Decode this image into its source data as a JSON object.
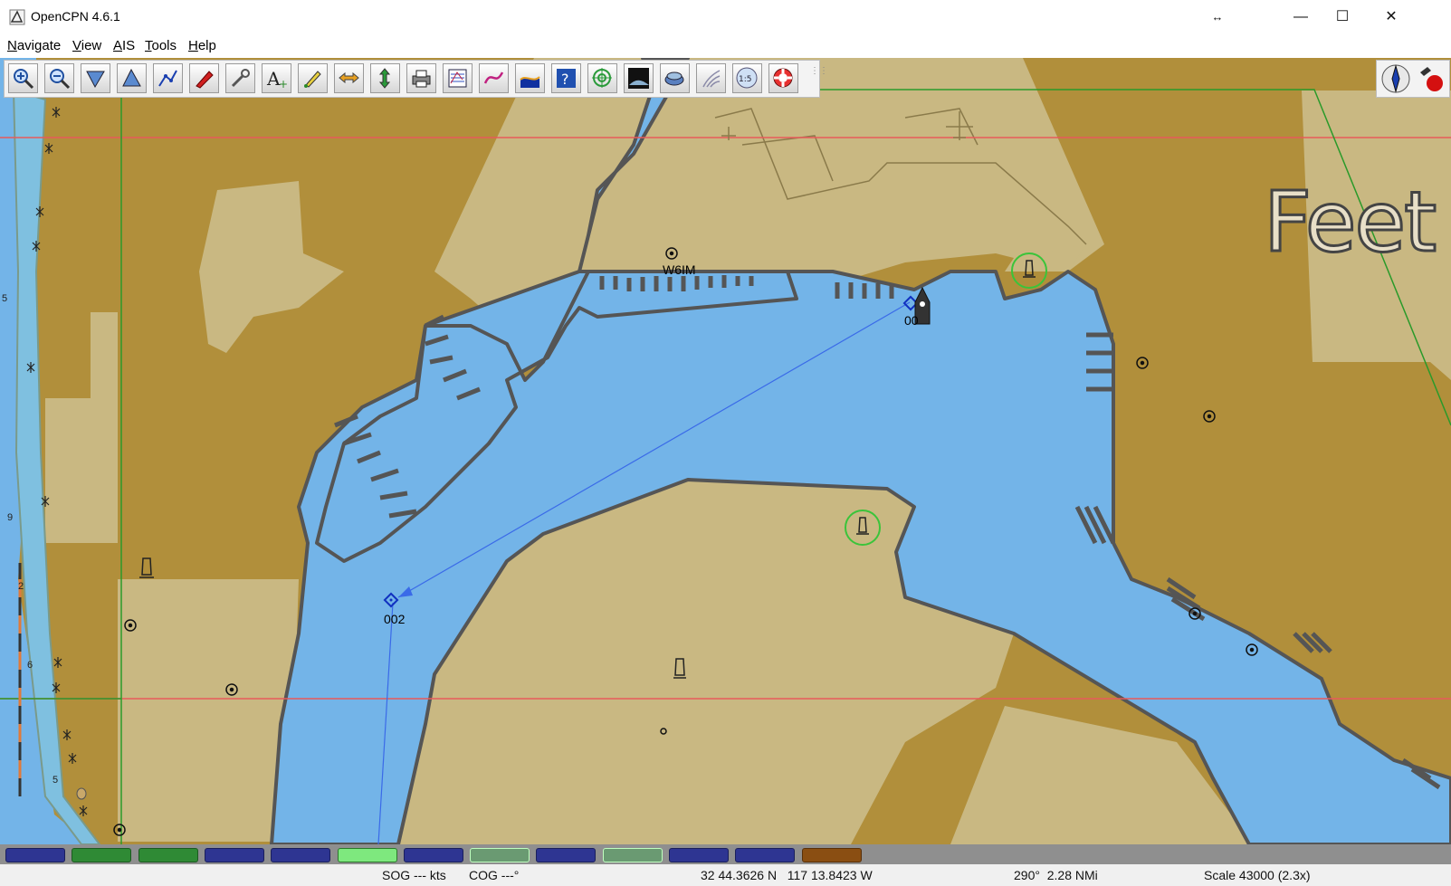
{
  "window": {
    "title": "OpenCPN 4.6.1",
    "resize_glyph": "↔",
    "minimize": "—",
    "maximize": "☐",
    "close": "✕"
  },
  "menu": {
    "items": [
      {
        "first": "N",
        "rest": "avigate"
      },
      {
        "first": "V",
        "rest": "iew"
      },
      {
        "first": "A",
        "rest": "IS"
      },
      {
        "first": "T",
        "rest": "ools"
      },
      {
        "first": "H",
        "rest": "elp"
      }
    ]
  },
  "toolbar": {
    "icons": [
      "zoom-in-icon",
      "zoom-out-icon",
      "scale-in-icon",
      "scale-out-icon",
      "route-icon",
      "ship-track-icon",
      "tools-wrench-icon",
      "text-mark-icon",
      "pencil-mark-icon",
      "arrows-horizontal-icon",
      "arrows-vertical-icon",
      "print-icon",
      "route-manager-icon",
      "tide-current-icon",
      "depth-tint-icon",
      "help-icon",
      "target-icon",
      "nightmode-icon",
      "chart-quilt-icon",
      "aid-icon",
      "scale-indicator-icon",
      "lifebuoy-icon"
    ],
    "scale_label": "1:5"
  },
  "chart": {
    "depth_unit_label": "Feet",
    "waypoints": [
      {
        "label": "002"
      },
      {
        "label": "00"
      }
    ],
    "station_label": "W6IM",
    "depth_soundings": [
      "5",
      "9",
      "2",
      "6",
      "5"
    ]
  },
  "piano": {
    "keys": [
      {
        "color": "#2e3592",
        "border": "#1a1f5c"
      },
      {
        "color": "#2f8a35",
        "border": "#1b5a20"
      },
      {
        "color": "#2f8a35",
        "border": "#1b5a20"
      },
      {
        "color": "#2e3592",
        "border": "#1a1f5c"
      },
      {
        "color": "#2e3592",
        "border": "#1a1f5c"
      },
      {
        "color": "#7ee87e",
        "border": "#2a7a2a"
      },
      {
        "color": "#2e3592",
        "border": "#1a1f5c"
      },
      {
        "color": "#6a9a72",
        "border": "#c0ffc0"
      },
      {
        "color": "#2e3592",
        "border": "#1a1f5c"
      },
      {
        "color": "#6a9a72",
        "border": "#c0ffc0"
      },
      {
        "color": "#2e3592",
        "border": "#1a1f5c"
      },
      {
        "color": "#2e3592",
        "border": "#1a1f5c"
      },
      {
        "color": "#8a4e12",
        "border": "#5a3008"
      }
    ]
  },
  "status": {
    "sog": "SOG --- kts",
    "cog": "COG ---°",
    "position": "32 44.3626 N   117 13.8423 W",
    "bearing_range": "290°  2.28 NMi",
    "scale": "Scale 43000 (2.3x)"
  },
  "colors": {
    "land_dark": "#b18f3b",
    "land_light": "#c9b882",
    "water": "#73b4e8",
    "coast": "#555555"
  }
}
